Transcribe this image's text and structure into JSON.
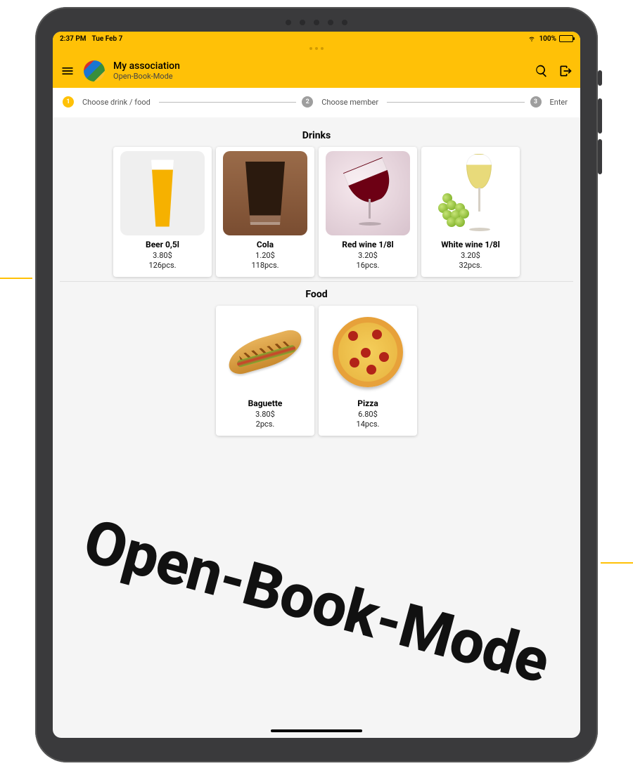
{
  "status_bar": {
    "time": "2:37 PM",
    "date": "Tue Feb 7",
    "battery_text": "100%"
  },
  "header": {
    "title": "My association",
    "subtitle": "Open-Book-Mode"
  },
  "stepper": {
    "steps": [
      {
        "num": "1",
        "label": "Choose drink / food",
        "active": true
      },
      {
        "num": "2",
        "label": "Choose member",
        "active": false
      },
      {
        "num": "3",
        "label": "Enter",
        "active": false
      }
    ]
  },
  "sections": {
    "drinks": {
      "title": "Drinks",
      "items": [
        {
          "name": "Beer 0,5l",
          "price": "3.80$",
          "stock": "126pcs."
        },
        {
          "name": "Cola",
          "price": "1.20$",
          "stock": "118pcs."
        },
        {
          "name": "Red wine 1/8l",
          "price": "3.20$",
          "stock": "16pcs."
        },
        {
          "name": "White wine 1/8l",
          "price": "3.20$",
          "stock": "32pcs."
        }
      ]
    },
    "food": {
      "title": "Food",
      "items": [
        {
          "name": "Baguette",
          "price": "3.80$",
          "stock": "2pcs."
        },
        {
          "name": "Pizza",
          "price": "6.80$",
          "stock": "14pcs."
        }
      ]
    }
  },
  "watermark": "Open-Book-Mode"
}
